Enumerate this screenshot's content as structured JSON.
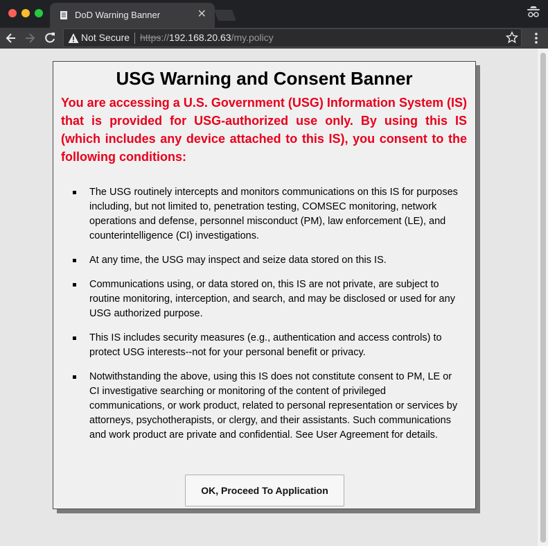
{
  "browser": {
    "tab": {
      "title": "DoD Warning Banner",
      "close_glyph": "✕"
    },
    "address": {
      "security_label": "Not Secure",
      "url_scheme": "https",
      "url_separator": "://",
      "url_host": "192.168.20.63",
      "url_path": "/my.policy"
    },
    "icons": [
      "document-icon",
      "incognito-icon",
      "back-icon",
      "forward-icon",
      "reload-icon",
      "warning-icon",
      "star-icon",
      "menu-icon"
    ],
    "colors": {
      "chrome_dark": "#202124",
      "toolbar": "#3c3c3e",
      "close_red": "#fe5f57",
      "minimize_yellow": "#febc2e",
      "zoom_green": "#28c840"
    }
  },
  "banner": {
    "title": "USG Warning and Consent Banner",
    "lead": "You are accessing a U.S. Government (USG) Information System (IS) that is provided for USG-authorized use only. By using this IS (which includes any device attached to this IS), you consent to the following conditions:",
    "conditions": [
      "The USG routinely intercepts and monitors communications on this IS for purposes including, but not limited to, penetration testing, COMSEC monitoring, network operations and defense, personnel misconduct (PM), law enforcement (LE), and counterintelligence (CI) investigations.",
      "At any time, the USG may inspect and seize data stored on this IS.",
      "Communications using, or data stored on, this IS are not private, are subject to routine monitoring, interception, and search, and may be disclosed or used for any USG authorized purpose.",
      "This IS includes security measures (e.g., authentication and access controls) to protect USG interests--not for your personal benefit or privacy.",
      "Notwithstanding the above, using this IS does not constitute consent to PM, LE or CI investigative searching or monitoring of the content of privileged communications, or work product, related to personal representation or services by attorneys, psychotherapists, or clergy, and their assistants. Such communications and work product are private and confidential. See User Agreement for details."
    ],
    "button_label": "OK, Proceed To Application",
    "colors": {
      "lead_text": "#e8001c",
      "panel": "#f0f0f0",
      "page": "#e6e6e6"
    }
  }
}
